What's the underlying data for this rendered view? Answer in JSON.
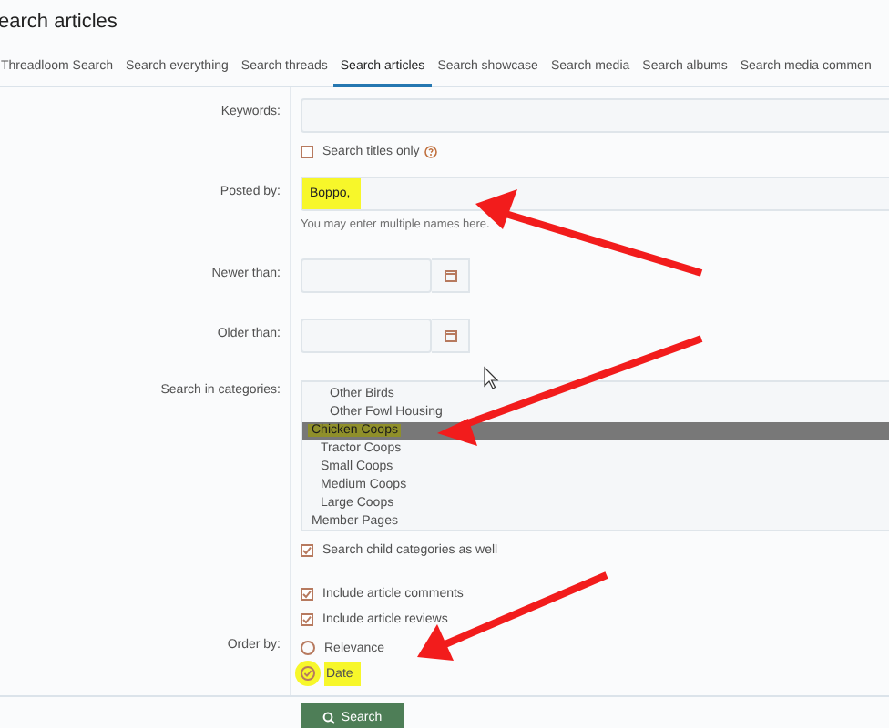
{
  "page_title": "earch articles",
  "tabs": [
    {
      "label": "Threadloom Search",
      "selected": false
    },
    {
      "label": "Search everything",
      "selected": false
    },
    {
      "label": "Search threads",
      "selected": false
    },
    {
      "label": "Search articles",
      "selected": true
    },
    {
      "label": "Search showcase",
      "selected": false
    },
    {
      "label": "Search media",
      "selected": false
    },
    {
      "label": "Search albums",
      "selected": false
    },
    {
      "label": "Search media commen",
      "selected": false
    }
  ],
  "keywords": {
    "label": "Keywords:",
    "titles_only": {
      "label": "Search titles only",
      "checked": false
    }
  },
  "posted_by": {
    "label": "Posted by:",
    "value": "Boppo,",
    "hint": "You may enter multiple names here."
  },
  "newer_than": {
    "label": "Newer than:"
  },
  "older_than": {
    "label": "Older than:"
  },
  "categories": {
    "label": "Search in categories:",
    "items": [
      {
        "children": [
          {
            "children": [
              {
                "label": "Other Birds",
                "selected": false
              },
              {
                "label": "Other Fowl Housing",
                "selected": false
              }
            ]
          }
        ]
      },
      {
        "label": "Chicken Coops",
        "selected": true,
        "children": [
          {
            "label": "Tractor Coops",
            "selected": false
          },
          {
            "label": "Small Coops",
            "selected": false
          },
          {
            "label": "Medium Coops",
            "selected": false
          },
          {
            "label": "Large Coops",
            "selected": false
          }
        ]
      },
      {
        "label": "Member Pages",
        "selected": false
      }
    ],
    "child_categories": {
      "label": "Search child categories as well",
      "checked": true
    }
  },
  "include": [
    {
      "label": "Include article comments",
      "checked": true
    },
    {
      "label": "Include article reviews",
      "checked": true
    }
  ],
  "order_by": {
    "label": "Order by:",
    "options": [
      {
        "label": "Relevance",
        "selected": false
      },
      {
        "label": "Date",
        "selected": true
      }
    ]
  },
  "submit": {
    "label": "Search"
  }
}
